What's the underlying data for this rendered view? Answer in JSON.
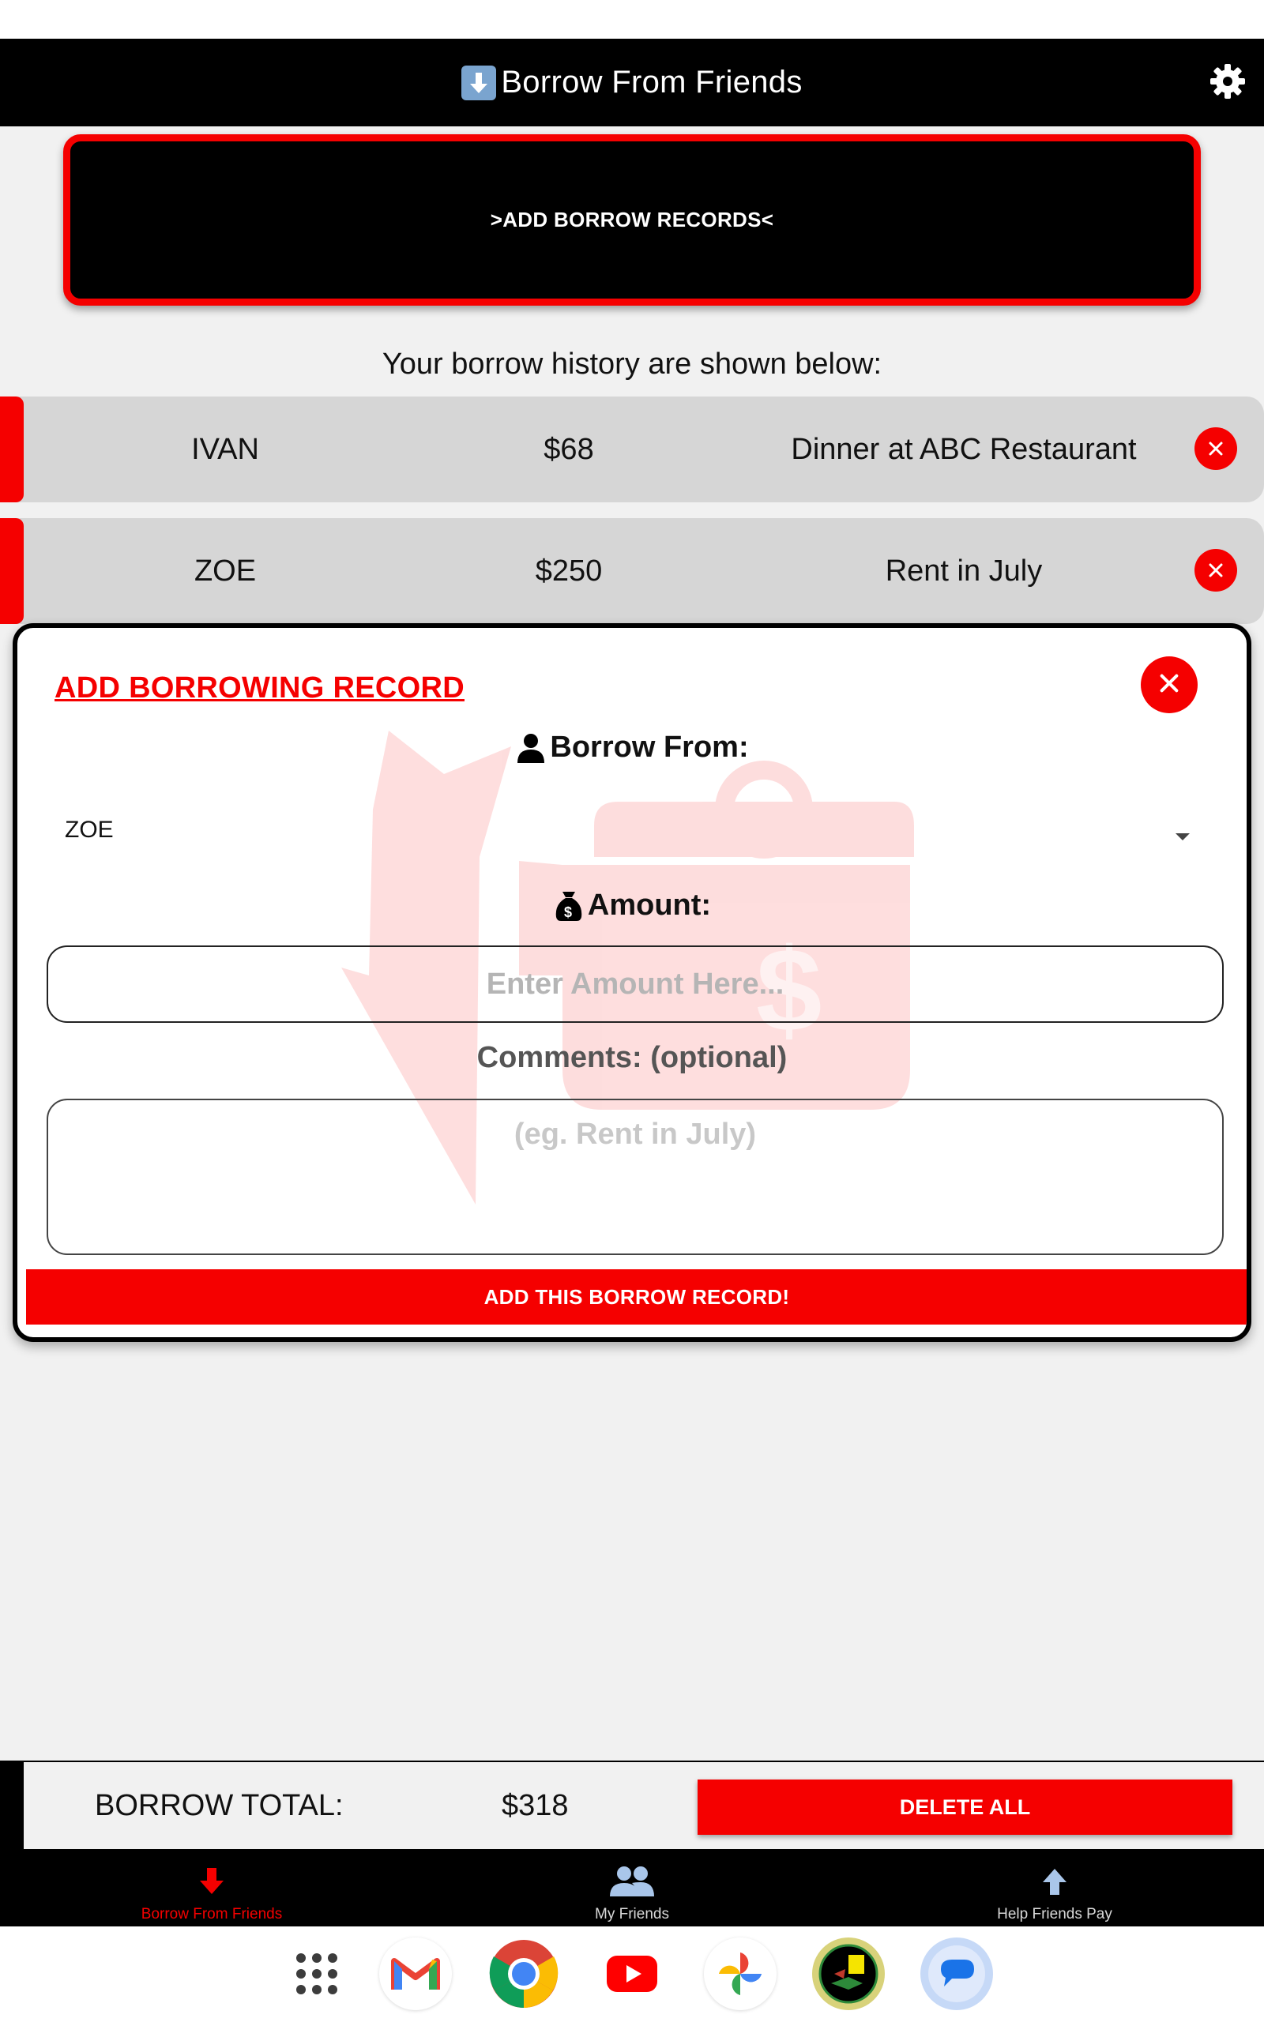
{
  "header": {
    "title": "Borrow From Friends",
    "title_icon": "down-arrow-emoji-icon",
    "settings_icon": "gear-icon"
  },
  "add_records_button": {
    "label": ">ADD BORROW RECORDS<"
  },
  "history_caption": "Your borrow history are shown below:",
  "records": [
    {
      "name": "IVAN",
      "amount": "$68",
      "comment": "Dinner at ABC Restaurant"
    },
    {
      "name": "ZOE",
      "amount": "$250",
      "comment": "Rent in July"
    }
  ],
  "dialog": {
    "title": "ADD BORROWING RECORD",
    "borrow_from_label": "Borrow From:",
    "borrow_from_value": "ZOE",
    "amount_label": "Amount:",
    "amount_placeholder": "Enter Amount Here...",
    "comments_label": "Comments: (optional)",
    "comments_placeholder": "(eg. Rent in July)",
    "submit_label": "ADD THIS BORROW RECORD!"
  },
  "totals": {
    "label": "BORROW TOTAL:",
    "amount": "$318",
    "delete_all_label": "DELETE ALL"
  },
  "bottom_nav": [
    {
      "label": "Borrow From Friends",
      "icon": "down-arrow-icon",
      "active": true
    },
    {
      "label": "My Friends",
      "icon": "users-icon",
      "active": false
    },
    {
      "label": "Help Friends Pay",
      "icon": "up-arrow-icon",
      "active": false
    }
  ],
  "dock": [
    "app-drawer-icon",
    "gmail-icon",
    "chrome-icon",
    "youtube-icon",
    "photos-icon",
    "app-icon",
    "messages-icon"
  ],
  "colors": {
    "accent_red": "#f50000",
    "header_bg": "#000000",
    "page_bg": "#f1f1f1",
    "row_bg": "#d6d6d6"
  }
}
